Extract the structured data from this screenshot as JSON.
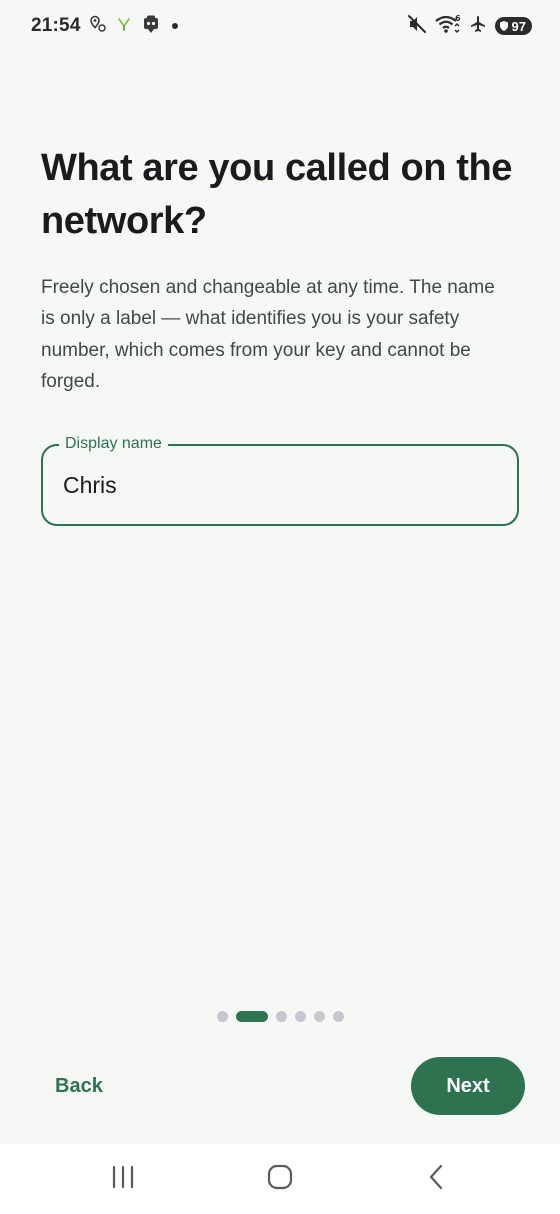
{
  "status_bar": {
    "time": "21:54",
    "battery": "97",
    "wifi_label": "6"
  },
  "screen": {
    "title": "What are you called on the network?",
    "description": "Freely chosen and changeable at any time. The name is only a label — what identifies you is your safety number, which comes from your key and cannot be forged.",
    "field": {
      "label": "Display name",
      "value": "Chris"
    }
  },
  "pager": {
    "total": 6,
    "current": 2
  },
  "footer": {
    "back_label": "Back",
    "next_label": "Next"
  },
  "colors": {
    "accent": "#2e7350",
    "background": "#f6f8f6",
    "inactive_dot": "#cbc5d2"
  },
  "icons": [
    "maps-pin-icon",
    "vpn-icon",
    "shield-app-icon",
    "notification-dot-icon",
    "mute-icon",
    "wifi-icon",
    "airplane-icon",
    "battery-icon",
    "recent-apps-icon",
    "home-icon",
    "back-icon"
  ]
}
